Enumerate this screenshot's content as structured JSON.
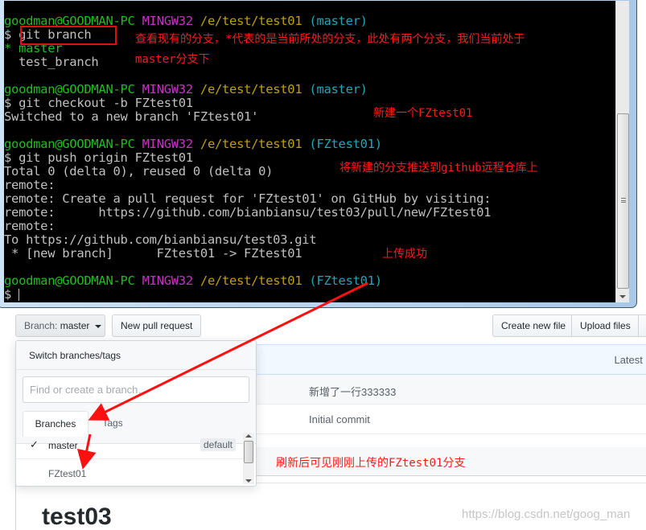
{
  "terminal": {
    "lines": [
      {
        "user": "goodman@GOODMAN-PC",
        "env": "MINGW32",
        "path": "/e/test/test01",
        "branch": "(master)"
      },
      {
        "text": "$ git branch"
      },
      {
        "text": "* master"
      },
      {
        "text": "  test_branch"
      },
      {
        "user": "goodman@GOODMAN-PC",
        "env": "MINGW32",
        "path": "/e/test/test01",
        "branch": "(master)"
      },
      {
        "text": "$ git checkout -b FZtest01"
      },
      {
        "text": "Switched to a new branch 'FZtest01'"
      },
      {
        "user": "goodman@GOODMAN-PC",
        "env": "MINGW32",
        "path": "/e/test/test01",
        "branch": "(FZtest01)"
      },
      {
        "text": "$ git push origin FZtest01"
      },
      {
        "text": "Total 0 (delta 0), reused 0 (delta 0)"
      },
      {
        "text": "remote:"
      },
      {
        "text": "remote: Create a pull request for 'FZtest01' on GitHub by visiting:"
      },
      {
        "text": "remote:      https://github.com/bianbiansu/test03/pull/new/FZtest01"
      },
      {
        "text": "remote:"
      },
      {
        "text": "To https://github.com/bianbiansu/test03.git"
      },
      {
        "text": " * [new branch]      FZtest01 -> FZtest01"
      },
      {
        "user": "goodman@GOODMAN-PC",
        "env": "MINGW32",
        "path": "/e/test/test01",
        "branch": "(FZtest01)"
      },
      {
        "text": "$ "
      }
    ],
    "annotations": {
      "branch_note_1": "查看现有的分支，*代表的是当前所处的分支，此处有两个分支，我们当前处于",
      "branch_note_2": "master分支下",
      "checkout_note": "新建一个FZtest01",
      "push_note": "将新建的分支推送到github远程仓库上",
      "success_note": "上传成功"
    }
  },
  "github": {
    "branch_button": {
      "label": "Branch:",
      "value": "master"
    },
    "new_pr_button": "New pull request",
    "create_file_button": "Create new file",
    "upload_button": "Upload files",
    "latest_commit": "Latest c",
    "files": [
      {
        "message": "新增了一行333333"
      },
      {
        "message": "Initial commit"
      }
    ],
    "refresh_note": "刷新后可见刚刚上传的FZtest01分支",
    "readme_title": "test03",
    "branch_menu": {
      "header": "Switch branches/tags",
      "filter_placeholder": "Find or create a branch…",
      "tabs": [
        "Branches",
        "Tags"
      ],
      "items": [
        {
          "name": "master",
          "selected": true,
          "badge": "default"
        },
        {
          "name": "FZtest01",
          "selected": false
        }
      ]
    }
  },
  "watermark": "https://blog.csdn.net/goog_man",
  "colors": {
    "annotation": "#ff1a1a",
    "prompt_user": "#1fbd1f",
    "prompt_env": "#c434c4",
    "prompt_path": "#c0a000",
    "prompt_branch": "#1fa6b8"
  }
}
